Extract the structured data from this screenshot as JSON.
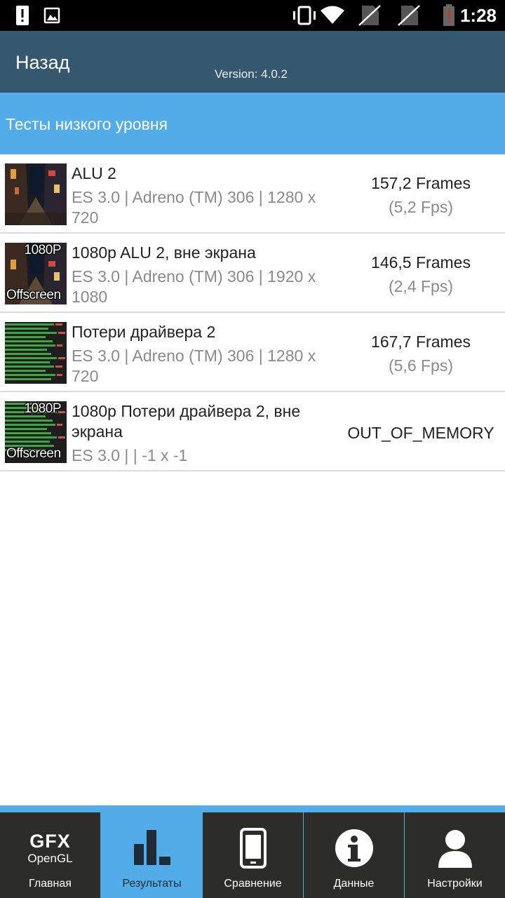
{
  "status_bar": {
    "time": "1:28",
    "icons": [
      "alert-icon",
      "image-icon",
      "vibrate-icon",
      "wifi-icon",
      "no-sim-icon",
      "no-sim-icon",
      "battery-low-icon"
    ]
  },
  "header": {
    "back_label": "Назад",
    "version": "Version: 4.0.2"
  },
  "section": {
    "title": "Тесты низкого уровня"
  },
  "results": [
    {
      "title": "ALU 2",
      "subtitle_line1": "ES 3.0 | Adreno (TM) 306 | 1280 x",
      "subtitle_line2": "720",
      "score": "157,2 Frames",
      "fps": "(5,2 Fps)",
      "thumb": "alu-scene",
      "thumb_badge_top": "",
      "thumb_badge_bottom": ""
    },
    {
      "title": "1080p ALU 2, вне экрана",
      "subtitle_line1": "ES 3.0 | Adreno (TM) 306 | 1920 x",
      "subtitle_line2": "1080",
      "score": "146,5 Frames",
      "fps": "(2,4 Fps)",
      "thumb": "alu-scene",
      "thumb_badge_top": "1080P",
      "thumb_badge_bottom": "Offscreen"
    },
    {
      "title": "Потери драйвера 2",
      "subtitle_line1": "ES 3.0 | Adreno (TM) 306 | 1280 x",
      "subtitle_line2": "720",
      "score": "167,7 Frames",
      "fps": "(5,6 Fps)",
      "thumb": "driver-bars",
      "thumb_badge_top": "",
      "thumb_badge_bottom": ""
    },
    {
      "title": "1080p Потери драйвера 2, вне экрана",
      "subtitle_line1": "ES 3.0 |  | -1 x -1",
      "subtitle_line2": "",
      "score": "OUT_OF_MEMORY",
      "fps": "",
      "thumb": "driver-bars",
      "thumb_badge_top": "1080P",
      "thumb_badge_bottom": "Offscreen"
    }
  ],
  "bottom_nav": {
    "items": [
      {
        "label": "Главная",
        "icon": "gfx-opengl-logo",
        "logo_big": "GFX",
        "logo_small": "OpenGL",
        "active": false
      },
      {
        "label": "Результаты",
        "icon": "bar-chart-icon",
        "active": true
      },
      {
        "label": "Сравнение",
        "icon": "phone-icon",
        "active": false
      },
      {
        "label": "Данные",
        "icon": "info-icon",
        "active": false
      },
      {
        "label": "Настройки",
        "icon": "user-icon",
        "active": false
      }
    ]
  },
  "colors": {
    "status_bar": "#000000",
    "header": "#35586e",
    "section": "#52acea",
    "nav_bg": "#2c2c28",
    "nav_active": "#52acea",
    "battery_alert": "#c0392b"
  }
}
